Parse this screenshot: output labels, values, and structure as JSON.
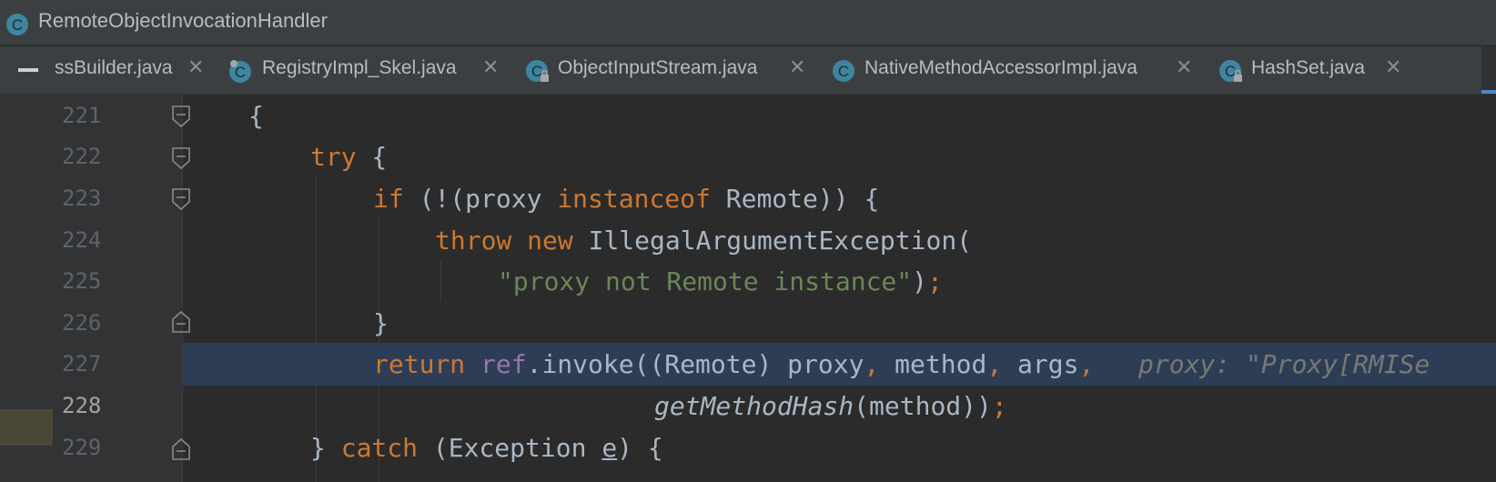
{
  "window": {
    "title": "RemoteObjectInvocationHandler",
    "icon": "class-icon"
  },
  "tabs": [
    {
      "label": "ssBuilder.java",
      "icon": "none"
    },
    {
      "label": "RegistryImpl_Skel.java",
      "icon": "class-icon"
    },
    {
      "label": "ObjectInputStream.java",
      "icon": "class-locked-icon"
    },
    {
      "label": "NativeMethodAccessorImpl.java",
      "icon": "class-icon"
    },
    {
      "label": "HashSet.java",
      "icon": "class-locked-icon"
    }
  ],
  "tab_close_glyph": "✕",
  "editor": {
    "current_line": 228,
    "highlighted_line": 227,
    "lines": [
      {
        "num": "221",
        "text": "{"
      },
      {
        "num": "222",
        "kw": "try",
        "text": " {"
      },
      {
        "num": "223",
        "kw": "if",
        "a": " (!(proxy ",
        "kw2": "instanceof",
        "b": " Remote)) {"
      },
      {
        "num": "224",
        "kw": "throw",
        "kw2": "new",
        "b": " IllegalArgumentException("
      },
      {
        "num": "225",
        "str": "\"proxy not Remote instance\"",
        "b": ")",
        "semi": ";"
      },
      {
        "num": "226",
        "text": "}"
      },
      {
        "num": "227",
        "kw": "return",
        "fld": "ref",
        "a": ".invoke((Remote) proxy",
        "c1": ",",
        "b": " method",
        "c2": ",",
        "d": " args",
        "c3": ",",
        "hint": "proxy: \"Proxy[RMISe"
      },
      {
        "num": "228",
        "ital": "getMethodHash",
        "b": "(method))",
        "semi": ";"
      },
      {
        "num": "229",
        "a": "} ",
        "kw": "catch",
        "b": " (Exception ",
        "var": "e",
        "c": ") {"
      }
    ]
  },
  "colors": {
    "keyword": "#cc7832",
    "string": "#6a8759",
    "field": "#9876aa",
    "text": "#a9b7c6",
    "highlight": "#2d3d55",
    "class_icon": "#3e86a0"
  }
}
